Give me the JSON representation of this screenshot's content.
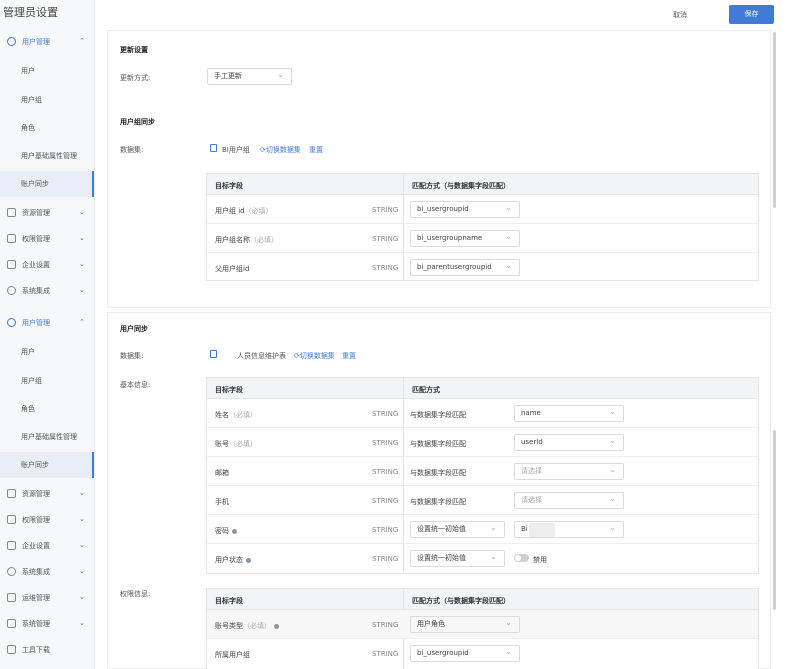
{
  "sidebar": {
    "title": "管理员设置",
    "group1": {
      "header": "用户管理",
      "items": [
        "用户",
        "用户组",
        "角色",
        "用户基础属性管理",
        "账户同步"
      ],
      "others": [
        "资源管理",
        "权限管理",
        "企业设置",
        "系统集成"
      ]
    },
    "group2": {
      "header": "用户管理",
      "items": [
        "用户",
        "用户组",
        "角色",
        "用户基础属性管理",
        "账户同步"
      ],
      "others": [
        "资源管理",
        "权限管理",
        "企业设置",
        "系统集成",
        "运维管理",
        "系统管理",
        "工具下载"
      ]
    }
  },
  "topbar": {
    "cancel": "取消",
    "save": "保存"
  },
  "update": {
    "title": "更新设置",
    "mode_label": "更新方式:",
    "mode_value": "手工更新"
  },
  "group_sync": {
    "title": "用户组同步",
    "dataset_label": "数据集:",
    "dataset_name": "BI用户组",
    "switch_link": "切换数据集",
    "reset_link": "重置",
    "headers": [
      "目标字段",
      "匹配方式（与数据集字段匹配）"
    ],
    "rows": [
      {
        "field": "用户组 id",
        "req": "（必填）",
        "type": "STRING",
        "value": "bi_usergroupid"
      },
      {
        "field": "用户组名称",
        "req": "（必填）",
        "type": "STRING",
        "value": "bi_usergroupname"
      },
      {
        "field": "父用户组id",
        "req": "",
        "type": "STRING",
        "value": "bi_parentusergroupid"
      }
    ]
  },
  "user_sync": {
    "title": "用户同步",
    "dataset_label": "数据集:",
    "dataset_name": "人员信息维护表",
    "switch_link": "切换数据集",
    "reset_link": "重置",
    "basic_label": "基本信息:",
    "headers": [
      "目标字段",
      "匹配方式"
    ],
    "rows": [
      {
        "field": "姓名",
        "req": "（必填）",
        "type": "STRING",
        "match": "与数据集字段匹配",
        "value": "name",
        "ph": false
      },
      {
        "field": "账号",
        "req": "（必填）",
        "type": "STRING",
        "match": "与数据集字段匹配",
        "value": "userId",
        "ph": false
      },
      {
        "field": "邮箱",
        "req": "",
        "type": "STRING",
        "match": "与数据集字段匹配",
        "value": "请选择",
        "ph": true
      },
      {
        "field": "手机",
        "req": "",
        "type": "STRING",
        "match": "与数据集字段匹配",
        "value": "请选择",
        "ph": true
      }
    ],
    "pwd": {
      "field": "密码",
      "type": "STRING",
      "match": "设置统一初始值",
      "value": "Bi"
    },
    "status": {
      "field": "用户状态",
      "type": "STRING",
      "match": "设置统一初始值",
      "toggle_label": "禁用"
    }
  },
  "perm": {
    "label": "权限信息:",
    "headers": [
      "目标字段",
      "匹配方式（与数据集字段匹配）"
    ],
    "rows": [
      {
        "field": "账号类型",
        "req": "（必填）",
        "type": "STRING",
        "value": "用户角色"
      },
      {
        "field": "所属用户组",
        "req": "",
        "type": "STRING",
        "value": "bi_usergroupid"
      }
    ]
  }
}
